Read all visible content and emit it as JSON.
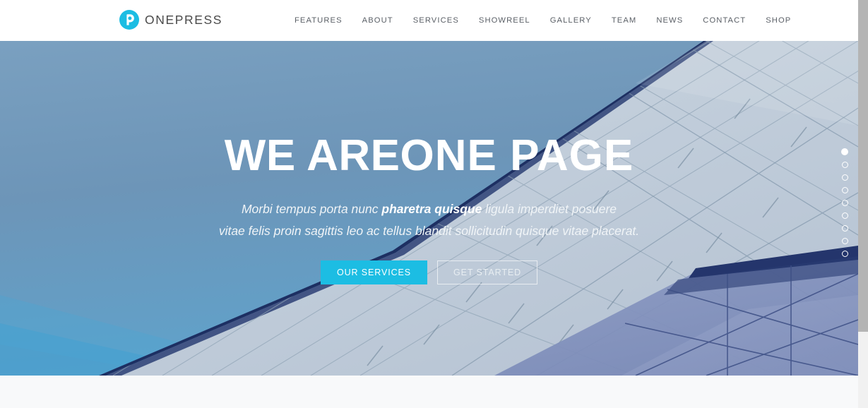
{
  "header": {
    "brand": {
      "icon": "onepress-circle-p-logo",
      "text": "ONEPRESS",
      "icon_color": "#1cbde3"
    },
    "nav": [
      {
        "label": "FEATURES"
      },
      {
        "label": "ABOUT"
      },
      {
        "label": "SERVICES"
      },
      {
        "label": "SHOWREEL"
      },
      {
        "label": "GALLERY"
      },
      {
        "label": "TEAM"
      },
      {
        "label": "NEWS"
      },
      {
        "label": "CONTACT"
      },
      {
        "label": "SHOP"
      }
    ]
  },
  "hero": {
    "title_strong": "WE ARE",
    "title_light": "ONE PAGE",
    "subtitle_line1_pre": "Morbi tempus porta nunc ",
    "subtitle_line1_bold": "pharetra quisque",
    "subtitle_line1_post": " ligula imperdiet posuere",
    "subtitle_line2": "vitae felis proin sagittis leo ac tellus blandit sollicitudin quisque vitae placerat.",
    "primary_button": "OUR SERVICES",
    "secondary_button": "GET STARTED",
    "primary_button_color": "#1cbde3",
    "background": "architectural-glass-facade-blue-sky",
    "sky_color": "#6f97b9",
    "facade_color": "#c3cfd8"
  },
  "slider_nav": {
    "total_dots": 9,
    "active_index": 0,
    "dots": [
      {
        "label": "slide-1",
        "active": true
      },
      {
        "label": "slide-2",
        "active": false
      },
      {
        "label": "slide-3",
        "active": false
      },
      {
        "label": "slide-4",
        "active": false
      },
      {
        "label": "slide-5",
        "active": false
      },
      {
        "label": "slide-6",
        "active": false
      },
      {
        "label": "slide-7",
        "active": false
      },
      {
        "label": "slide-8",
        "active": false
      },
      {
        "label": "slide-9",
        "active": false
      }
    ]
  },
  "below_fold": {
    "background_color": "#f8f9fa"
  },
  "scrollbar": {
    "thumb_color": "#b4b4b4",
    "track_color": "#f1f1f1"
  }
}
